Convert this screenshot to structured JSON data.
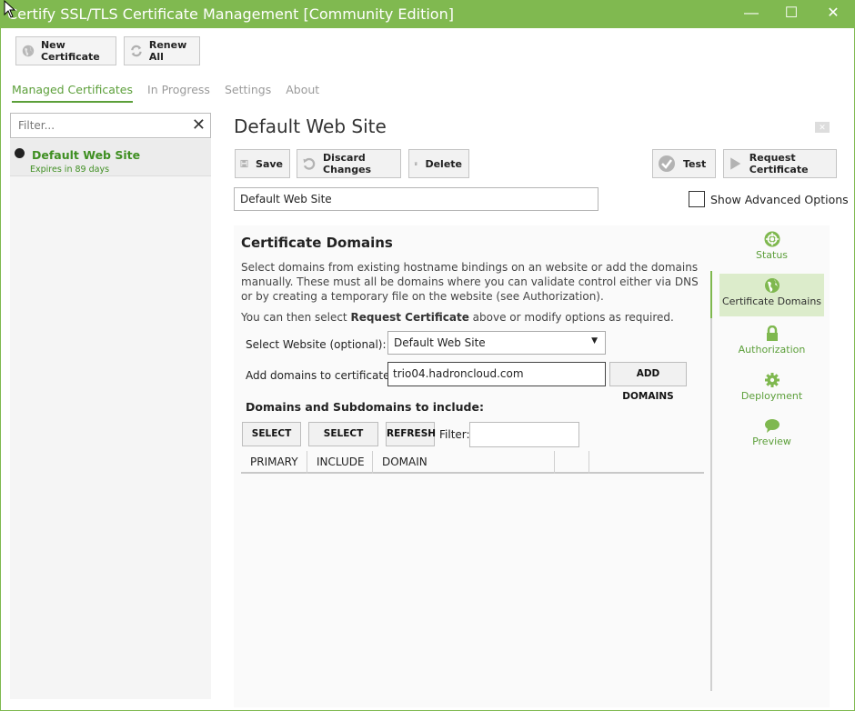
{
  "window": {
    "title": "Certify SSL/TLS Certificate Management [Community Edition]",
    "controls": {
      "minimize": "—",
      "maximize": "☐",
      "close": "✕"
    }
  },
  "toolbar": {
    "new_certificate": "New Certificate",
    "renew_all": "Renew All"
  },
  "main_tabs": [
    {
      "label": "Managed Certificates",
      "active": true
    },
    {
      "label": "In Progress",
      "active": false
    },
    {
      "label": "Settings",
      "active": false
    },
    {
      "label": "About",
      "active": false
    }
  ],
  "sidebar": {
    "filter_placeholder": "Filter...",
    "items": [
      {
        "name": "Default Web Site",
        "expiry": "Expires in 89 days"
      }
    ]
  },
  "detail": {
    "title": "Default Web Site",
    "actions": {
      "save": "Save",
      "discard": "Discard Changes",
      "delete": "Delete",
      "test": "Test",
      "request": "Request Certificate"
    },
    "name_value": "Default Web Site",
    "advanced_options_label": "Show Advanced Options"
  },
  "domains": {
    "section_title": "Certificate Domains",
    "description": "Select domains from existing hostname bindings on an website or add the domains manually. These must all be domains where you can validate control either via DNS or by creating a temporary file on the website (see Authorization).",
    "hint_prefix": "You can then select ",
    "hint_bold": "Request Certificate",
    "hint_suffix": " above or modify options as required.",
    "select_website_label": "Select Website (optional):",
    "select_website_value": "Default Web Site",
    "add_domains_label": "Add domains to certificate:",
    "add_domains_value": "trio04.hadroncloud.com",
    "add_domains_button": "ADD DOMAINS",
    "subheading": "Domains and Subdomains to include:",
    "select_all": "SELECT ALL",
    "select_none": "SELECT NONE",
    "refresh": "REFRESH",
    "filter_label": "Filter:",
    "columns": [
      "PRIMARY",
      "INCLUDE",
      "DOMAIN",
      "",
      ""
    ]
  },
  "side_nav": [
    {
      "label": "Status",
      "icon": "lifebuoy-icon",
      "active": false
    },
    {
      "label": "Certificate Domains",
      "icon": "globe-icon",
      "active": true
    },
    {
      "label": "Authorization",
      "icon": "lock-icon",
      "active": false
    },
    {
      "label": "Deployment",
      "icon": "gear-icon",
      "active": false
    },
    {
      "label": "Preview",
      "icon": "chat-bubble-icon",
      "active": false
    }
  ],
  "colors": {
    "accent": "#80b950",
    "accent_text": "#5c9f3a",
    "active_nav_bg": "#dceccb"
  }
}
